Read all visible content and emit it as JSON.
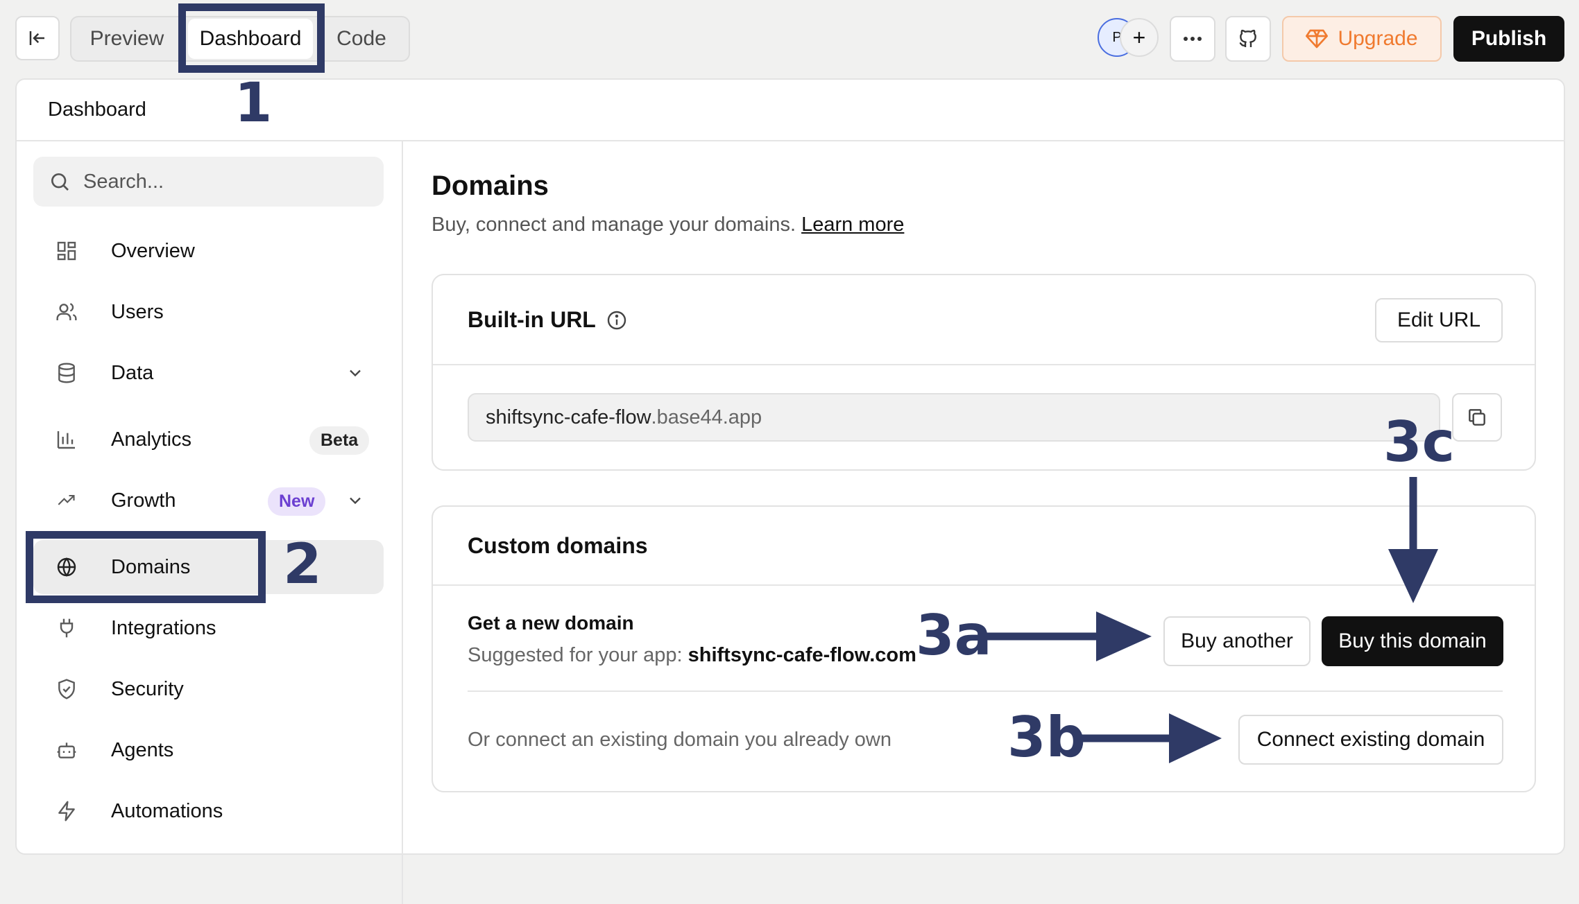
{
  "topbar": {
    "tabs": [
      {
        "label": "Preview"
      },
      {
        "label": "Dashboard"
      },
      {
        "label": "Code"
      }
    ],
    "avatar_initial": "P",
    "upgrade_label": "Upgrade",
    "publish_label": "Publish"
  },
  "dashboard": {
    "header_title": "Dashboard"
  },
  "sidebar": {
    "search_placeholder": "Search...",
    "items": [
      {
        "label": "Overview",
        "icon": "grid-icon"
      },
      {
        "label": "Users",
        "icon": "users-icon"
      },
      {
        "label": "Data",
        "icon": "database-icon"
      },
      {
        "label": "Analytics",
        "icon": "bar-chart-icon",
        "badge": "Beta"
      },
      {
        "label": "Growth",
        "icon": "trending-up-icon",
        "badge": "New"
      },
      {
        "label": "Domains",
        "icon": "globe-icon",
        "active": true
      },
      {
        "label": "Integrations",
        "icon": "plug-icon"
      },
      {
        "label": "Security",
        "icon": "shield-icon"
      },
      {
        "label": "Agents",
        "icon": "bot-icon"
      },
      {
        "label": "Automations",
        "icon": "lightning-icon"
      }
    ]
  },
  "main": {
    "title": "Domains",
    "subtitle": "Buy, connect and manage your domains.",
    "learn_more": "Learn more",
    "builtin": {
      "title": "Built-in URL",
      "edit_label": "Edit URL",
      "url_sub": "shiftsync-cafe-flow",
      "url_domain": ".base44.app"
    },
    "custom": {
      "title": "Custom domains",
      "new_title": "Get a new domain",
      "suggest_prefix": "Suggested for your app:",
      "suggest_domain": "shiftsync-cafe-flow.com",
      "buy_another": "Buy another",
      "buy_this": "Buy this domain",
      "connect_text": "Or connect an existing domain you already own",
      "connect_label": "Connect existing domain"
    }
  },
  "annotations": {
    "n1": "1",
    "n2": "2",
    "n3a": "3a",
    "n3b": "3b",
    "n3c": "3c"
  },
  "colors": {
    "annotation": "#2f3a66",
    "upgrade": "#f07a2f",
    "new_badge": "#6b3fd1"
  }
}
